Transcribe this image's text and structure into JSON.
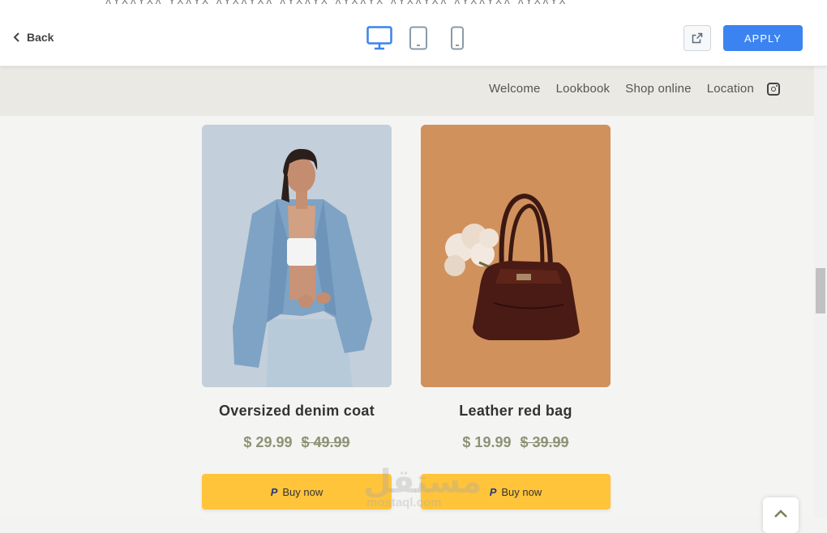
{
  "editor": {
    "back_label": "Back",
    "apply_label": "APPLY",
    "devices": [
      "desktop",
      "tablet",
      "mobile"
    ],
    "active_device": "desktop"
  },
  "site": {
    "nav": [
      "Welcome",
      "Lookbook",
      "Shop online",
      "Location"
    ],
    "products": [
      {
        "name": "Oversized denim coat",
        "price": "$ 29.99",
        "old_price": "$ 49.99",
        "button_label": "Buy now",
        "button_icon": "paypal-icon"
      },
      {
        "name": "Leather red bag",
        "price": "$ 19.99",
        "old_price": "$ 39.99",
        "button_label": "Buy now",
        "button_icon": "paypal-icon"
      }
    ]
  },
  "colors": {
    "apply": "#3b83f0",
    "buy_button": "#ffc43a",
    "price": "#8c9275",
    "active_device": "#3b83f0"
  }
}
